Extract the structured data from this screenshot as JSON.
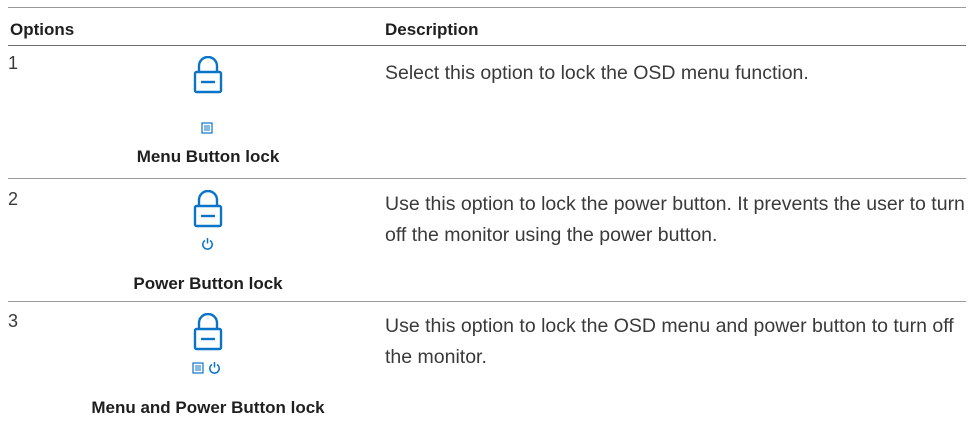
{
  "header": {
    "options_label": "Options",
    "description_label": "Description"
  },
  "rows": [
    {
      "number": "1",
      "caption": "Menu Button lock",
      "description": "Select this option to lock the OSD menu function.",
      "icons": [
        "lock-icon",
        "menu-icon"
      ]
    },
    {
      "number": "2",
      "caption": "Power Button lock",
      "description": "Use this option to lock the power button. It prevents the user to turn off the monitor using the power button.",
      "icons": [
        "lock-icon",
        "power-icon"
      ]
    },
    {
      "number": "3",
      "caption": "Menu and Power Button lock",
      "description": "Use this option to lock the OSD menu and power button to turn off the monitor.",
      "icons": [
        "lock-icon",
        "menu-icon",
        "power-icon"
      ]
    }
  ],
  "colors": {
    "icon_accent": "#0a74c9",
    "rule": "#9a9a9a",
    "text": "#3a3a3a"
  }
}
